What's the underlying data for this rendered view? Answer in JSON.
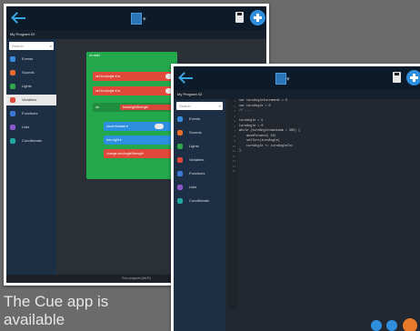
{
  "editor_window": {
    "program_title": "My Program 02",
    "search_placeholder": "Search",
    "categories": [
      {
        "label": "Events",
        "color": "#3a8ce0"
      },
      {
        "label": "Sounds",
        "color": "#e86a2e"
      },
      {
        "label": "Lights",
        "color": "#2ea848"
      },
      {
        "label": "Variables",
        "color": "#e0493a"
      },
      {
        "label": "Functions",
        "color": "#3a7ad6"
      },
      {
        "label": "Lists",
        "color": "#8a58c8"
      },
      {
        "label": "Conditionals",
        "color": "#22a7a0"
      }
    ],
    "selected_category_index": 3,
    "blocks": {
      "event_header": "on start",
      "set1": "set  turnAngle ▾  to",
      "set2": "set  turnAngle ▾  to",
      "call_label": "do",
      "call_arg": "turnAngleStrength",
      "inner1": "move  forward ▾",
      "inner2": "turn  right ▾",
      "inner3": "change  turnAngleStrength"
    },
    "status_text": "Run program (Alt-R)"
  },
  "code_window": {
    "program_title": "My Program 02",
    "search_placeholder": "Search",
    "categories": [
      {
        "label": "Events",
        "color": "#3a8ce0"
      },
      {
        "label": "Sounds",
        "color": "#e86a2e"
      },
      {
        "label": "Lights",
        "color": "#2ea848"
      },
      {
        "label": "Variables",
        "color": "#e0493a"
      },
      {
        "label": "Functions",
        "color": "#3a7ad6"
      },
      {
        "label": "Lists",
        "color": "#8a58c8"
      },
      {
        "label": "Conditionals",
        "color": "#22a7a0"
      }
    ],
    "line_numbers": [
      "1",
      "2",
      "3",
      "4",
      "5",
      "6",
      "7",
      "8",
      "9",
      "10",
      "11",
      "12",
      "13",
      "14",
      "15"
    ],
    "code_lines": [
      "var turnAngleIncrement = 5",
      "var turnAngle = 0",
      "// ...",
      "",
      "turnAngle = 5",
      "turnAngle = 0",
      "while (turnAngle&lt;maximum &lt; 360) {",
      "    moveForward( 10)",
      "    setTurn(turnAngle)",
      "    turnAngle += turnAngleInc",
      "}",
      "",
      "",
      "",
      ""
    ]
  },
  "caption": {
    "line1": "The Cue app is",
    "line2": "available"
  }
}
